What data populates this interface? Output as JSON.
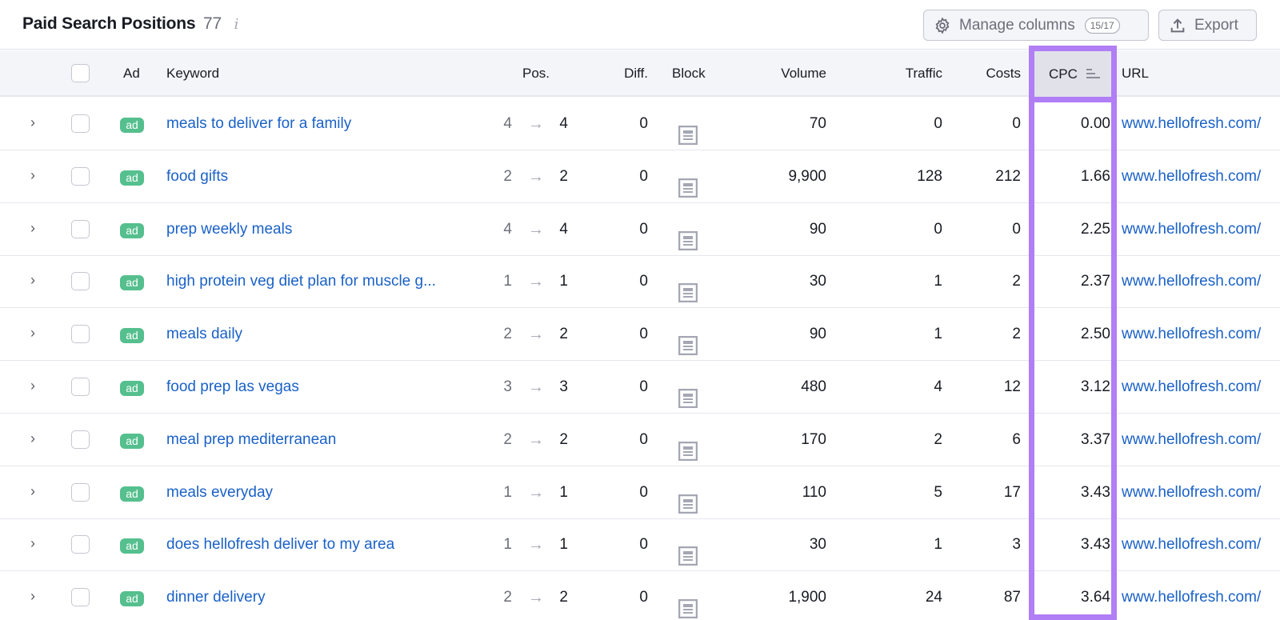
{
  "header": {
    "title": "Paid Search Positions",
    "count": "77",
    "info_icon": "i",
    "manage_columns_label": "Manage columns",
    "manage_columns_badge": "15/17",
    "export_label": "Export"
  },
  "columns": {
    "ad": "Ad",
    "keyword": "Keyword",
    "pos": "Pos.",
    "diff": "Diff.",
    "block": "Block",
    "volume": "Volume",
    "traffic": "Traffic",
    "costs": "Costs",
    "cpc": "CPC",
    "url": "URL"
  },
  "sort": {
    "column": "cpc",
    "direction": "ascending"
  },
  "highlight_color": "#b07ef5",
  "rows": [
    {
      "ad": "ad",
      "keyword": "meals to deliver for a family",
      "pos_prev": "4",
      "arrow": "→",
      "pos": "4",
      "diff": "0",
      "volume": "70",
      "traffic": "0",
      "costs": "0",
      "cpc": "0.00",
      "url": "www.hellofresh.com/"
    },
    {
      "ad": "ad",
      "keyword": "food gifts",
      "pos_prev": "2",
      "arrow": "→",
      "pos": "2",
      "diff": "0",
      "volume": "9,900",
      "traffic": "128",
      "costs": "212",
      "cpc": "1.66",
      "url": "www.hellofresh.com/"
    },
    {
      "ad": "ad",
      "keyword": "prep weekly meals",
      "pos_prev": "4",
      "arrow": "→",
      "pos": "4",
      "diff": "0",
      "volume": "90",
      "traffic": "0",
      "costs": "0",
      "cpc": "2.25",
      "url": "www.hellofresh.com/"
    },
    {
      "ad": "ad",
      "keyword": "high protein veg diet plan for muscle g...",
      "pos_prev": "1",
      "arrow": "→",
      "pos": "1",
      "diff": "0",
      "volume": "30",
      "traffic": "1",
      "costs": "2",
      "cpc": "2.37",
      "url": "www.hellofresh.com/"
    },
    {
      "ad": "ad",
      "keyword": "meals daily",
      "pos_prev": "2",
      "arrow": "→",
      "pos": "2",
      "diff": "0",
      "volume": "90",
      "traffic": "1",
      "costs": "2",
      "cpc": "2.50",
      "url": "www.hellofresh.com/"
    },
    {
      "ad": "ad",
      "keyword": "food prep las vegas",
      "pos_prev": "3",
      "arrow": "→",
      "pos": "3",
      "diff": "0",
      "volume": "480",
      "traffic": "4",
      "costs": "12",
      "cpc": "3.12",
      "url": "www.hellofresh.com/"
    },
    {
      "ad": "ad",
      "keyword": "meal prep mediterranean",
      "pos_prev": "2",
      "arrow": "→",
      "pos": "2",
      "diff": "0",
      "volume": "170",
      "traffic": "2",
      "costs": "6",
      "cpc": "3.37",
      "url": "www.hellofresh.com/"
    },
    {
      "ad": "ad",
      "keyword": "meals everyday",
      "pos_prev": "1",
      "arrow": "→",
      "pos": "1",
      "diff": "0",
      "volume": "110",
      "traffic": "5",
      "costs": "17",
      "cpc": "3.43",
      "url": "www.hellofresh.com/"
    },
    {
      "ad": "ad",
      "keyword": "does hellofresh deliver to my area",
      "pos_prev": "1",
      "arrow": "→",
      "pos": "1",
      "diff": "0",
      "volume": "30",
      "traffic": "1",
      "costs": "3",
      "cpc": "3.43",
      "url": "www.hellofresh.com/"
    },
    {
      "ad": "ad",
      "keyword": "dinner delivery",
      "pos_prev": "2",
      "arrow": "→",
      "pos": "2",
      "diff": "0",
      "volume": "1,900",
      "traffic": "24",
      "costs": "87",
      "cpc": "3.64",
      "url": "www.hellofresh.com/"
    }
  ]
}
